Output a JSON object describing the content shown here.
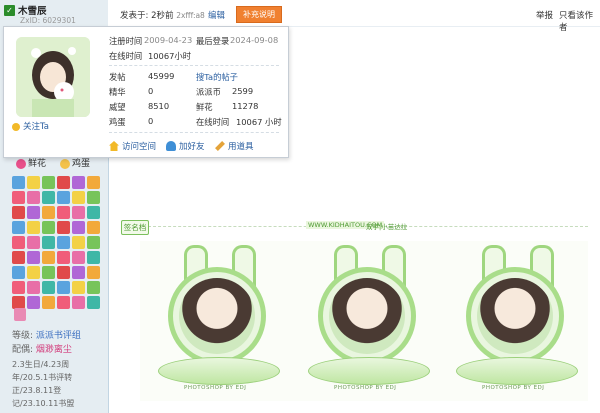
{
  "user": {
    "name": "木雪辰",
    "zxid": "ZxID: 6029301"
  },
  "post_bar": {
    "posted": "发表于: 2秒前",
    "ip": "2xfff:a8",
    "edit": "编辑",
    "supplement": "补充说明",
    "report": "举报",
    "only_author": "只看该作者"
  },
  "card": {
    "rows": [
      {
        "label": "注册时间",
        "value": "2009-04-23",
        "label2": "最后登录",
        "value2": "2024-09-08"
      },
      {
        "label": "在线时间",
        "value": "10067小时"
      }
    ],
    "stats": [
      {
        "label": "发帖",
        "value": "45999",
        "label2": "搜Ta的帖子",
        "value2": ""
      },
      {
        "label": "精华",
        "value": "0",
        "label2": "派派币",
        "value2": "2599"
      },
      {
        "label": "威望",
        "value": "8510",
        "label2": "鲜花",
        "value2": "11278"
      },
      {
        "label": "鸡蛋",
        "value": "0",
        "label2": "在线时间",
        "value2": "10067 小时"
      }
    ],
    "follow": "关注Ta",
    "actions": [
      "访问空间",
      "加好友",
      "用道具"
    ]
  },
  "sidebar": {
    "flower": "鲜花",
    "egg": "鸡蛋",
    "level_label": "等级:",
    "level_value": "派派书评组",
    "role_label": "配偶:",
    "role_value": "烟渺离尘",
    "desc": "2.3生日/4.23周年/20.5.1书评转正/23.8.11登记/23.10.11书盟"
  },
  "signature": {
    "tag": "签名档",
    "url": "WWW.KIDHAITOU.COM",
    "note": "双宇|小苗达拉"
  },
  "images": [
    {
      "caption": "PHOTOSHOP BY EDJ"
    },
    {
      "caption": "PHOTOSHOP BY EDJ"
    },
    {
      "caption": "PHOTOSHOP BY EDJ"
    }
  ],
  "colors": {
    "accent_orange": "#f08030",
    "link_blue": "#2b5fa0",
    "sig_green": "#4e9a32",
    "sidebar_bg": "#e5edf2"
  }
}
